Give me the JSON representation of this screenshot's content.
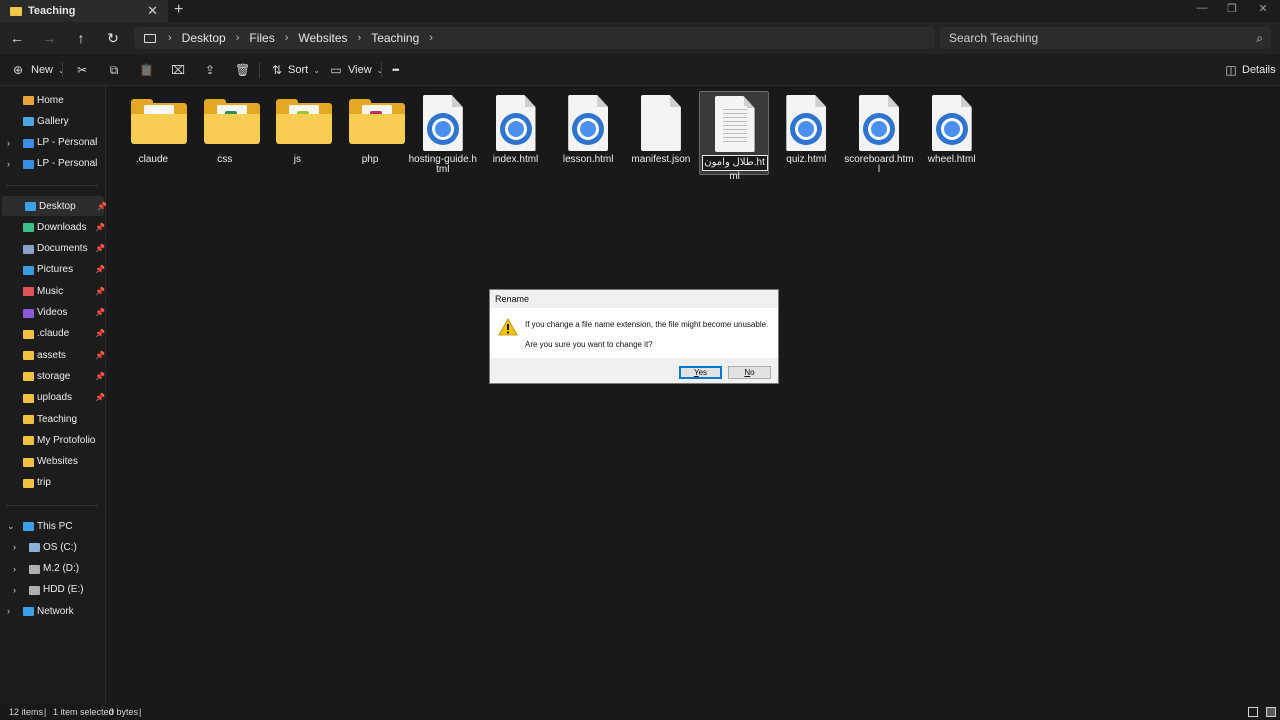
{
  "window": {
    "tab_title": "Teaching",
    "tab_close": "✕",
    "new_tab": "+"
  },
  "window_controls": {
    "minimize": "—",
    "maximize": "❐",
    "close": "✕"
  },
  "nav": {
    "back": "←",
    "forward": "→",
    "up": "↑",
    "refresh": "↻"
  },
  "breadcrumbs": [
    "Desktop",
    "Files",
    "Websites",
    "Teaching"
  ],
  "breadcrumb_separator": "›",
  "search": {
    "placeholder": "Search Teaching",
    "icon": "⌕"
  },
  "toolbar": {
    "new_label": "New",
    "sort_label": "Sort",
    "view_label": "View",
    "more_label": "•••",
    "details_label": "Details",
    "caret": "⌄",
    "icons": {
      "new": "⊕",
      "cut": "✂",
      "copy": "⧉",
      "paste": "📋",
      "rename": "⌧",
      "share": "⇪",
      "delete": "🗑",
      "sort": "⇅",
      "view": "▭",
      "details": "◫"
    }
  },
  "sidebar": {
    "top": [
      {
        "label": "Home",
        "icon": "home-icon",
        "color": "#e8a33b",
        "chevron": false
      },
      {
        "label": "Gallery",
        "icon": "gallery-icon",
        "color": "#4aa8e0",
        "chevron": false
      },
      {
        "label": "LP - Personal",
        "icon": "cloud-icon",
        "color": "#3b8ee6",
        "chevron": true
      },
      {
        "label": "LP - Personal",
        "icon": "cloud-icon",
        "color": "#3b8ee6",
        "chevron": true
      }
    ],
    "pinned": [
      {
        "label": "Desktop",
        "icon": "desktop-icon",
        "color": "#3aa0e8",
        "active": true
      },
      {
        "label": "Downloads",
        "icon": "downloads-icon",
        "color": "#3bbf8a"
      },
      {
        "label": "Documents",
        "icon": "documents-icon",
        "color": "#8aa0c8"
      },
      {
        "label": "Pictures",
        "icon": "pictures-icon",
        "color": "#3a9ce0"
      },
      {
        "label": "Music",
        "icon": "music-icon",
        "color": "#e0555a"
      },
      {
        "label": "Videos",
        "icon": "videos-icon",
        "color": "#8a5ad8"
      },
      {
        "label": ".claude",
        "icon": "folder-icon",
        "color": "#f0c040"
      },
      {
        "label": "assets",
        "icon": "folder-icon",
        "color": "#f0c040"
      },
      {
        "label": "storage",
        "icon": "folder-icon",
        "color": "#f0c040"
      },
      {
        "label": "uploads",
        "icon": "folder-icon",
        "color": "#f0c040"
      },
      {
        "label": "Teaching",
        "icon": "folder-icon",
        "color": "#f0c040",
        "pin": false
      },
      {
        "label": "My Protofolio",
        "icon": "folder-icon",
        "color": "#f0c040",
        "pin": false
      },
      {
        "label": "Websites",
        "icon": "folder-icon",
        "color": "#f0c040",
        "pin": false
      },
      {
        "label": "trip",
        "icon": "folder-icon",
        "color": "#f0c040",
        "pin": false
      }
    ],
    "this_pc": {
      "label": "This PC",
      "icon": "pc-icon",
      "color": "#3aa0e8"
    },
    "drives": [
      {
        "label": "OS (C:)",
        "icon": "drive-icon",
        "color": "#8ab0d8"
      },
      {
        "label": "M.2 (D:)",
        "icon": "drive-icon",
        "color": "#b0b0b0"
      },
      {
        "label": "HDD (E:)",
        "icon": "drive-icon",
        "color": "#b0b0b0"
      }
    ],
    "network": {
      "label": "Network",
      "icon": "network-icon",
      "color": "#3aa0e8"
    },
    "pin_glyph": "📌",
    "chevron_right": "›",
    "chevron_down": "⌄"
  },
  "files": [
    {
      "name": ".claude",
      "type": "folder",
      "accent": "#ffffff"
    },
    {
      "name": "css",
      "type": "folder",
      "accent": "#2f8f4e"
    },
    {
      "name": "js",
      "type": "folder",
      "accent": "#9bc53d"
    },
    {
      "name": "php",
      "type": "folder",
      "accent": "#c0305a"
    },
    {
      "name": "hosting-guide.html",
      "type": "chrome"
    },
    {
      "name": "index.html",
      "type": "chrome"
    },
    {
      "name": "lesson.html",
      "type": "chrome"
    },
    {
      "name": "manifest.json",
      "type": "blank"
    },
    {
      "name": "طلال وامون.html",
      "type": "text",
      "selected": true,
      "renaming": true
    },
    {
      "name": "quiz.html",
      "type": "chrome"
    },
    {
      "name": "scoreboard.html",
      "type": "chrome"
    },
    {
      "name": "wheel.html",
      "type": "chrome"
    }
  ],
  "status": {
    "count": "12 items",
    "selection": "1 item selected",
    "size": "0 bytes",
    "sep": "|"
  },
  "dialog": {
    "title": "Rename",
    "message": "If you change a file name extension, the file might become unusable.",
    "question": "Are you sure you want to change it?",
    "yes_first": "Y",
    "yes_rest": "es",
    "no_first": "N",
    "no_rest": "o"
  },
  "colors": {
    "folder_back": "#e5a823",
    "folder_front": "#f7cd52",
    "chrome_blue": "#2f74d0",
    "accent_blue": "#0078d4",
    "warning_yellow": "#f5c400"
  }
}
